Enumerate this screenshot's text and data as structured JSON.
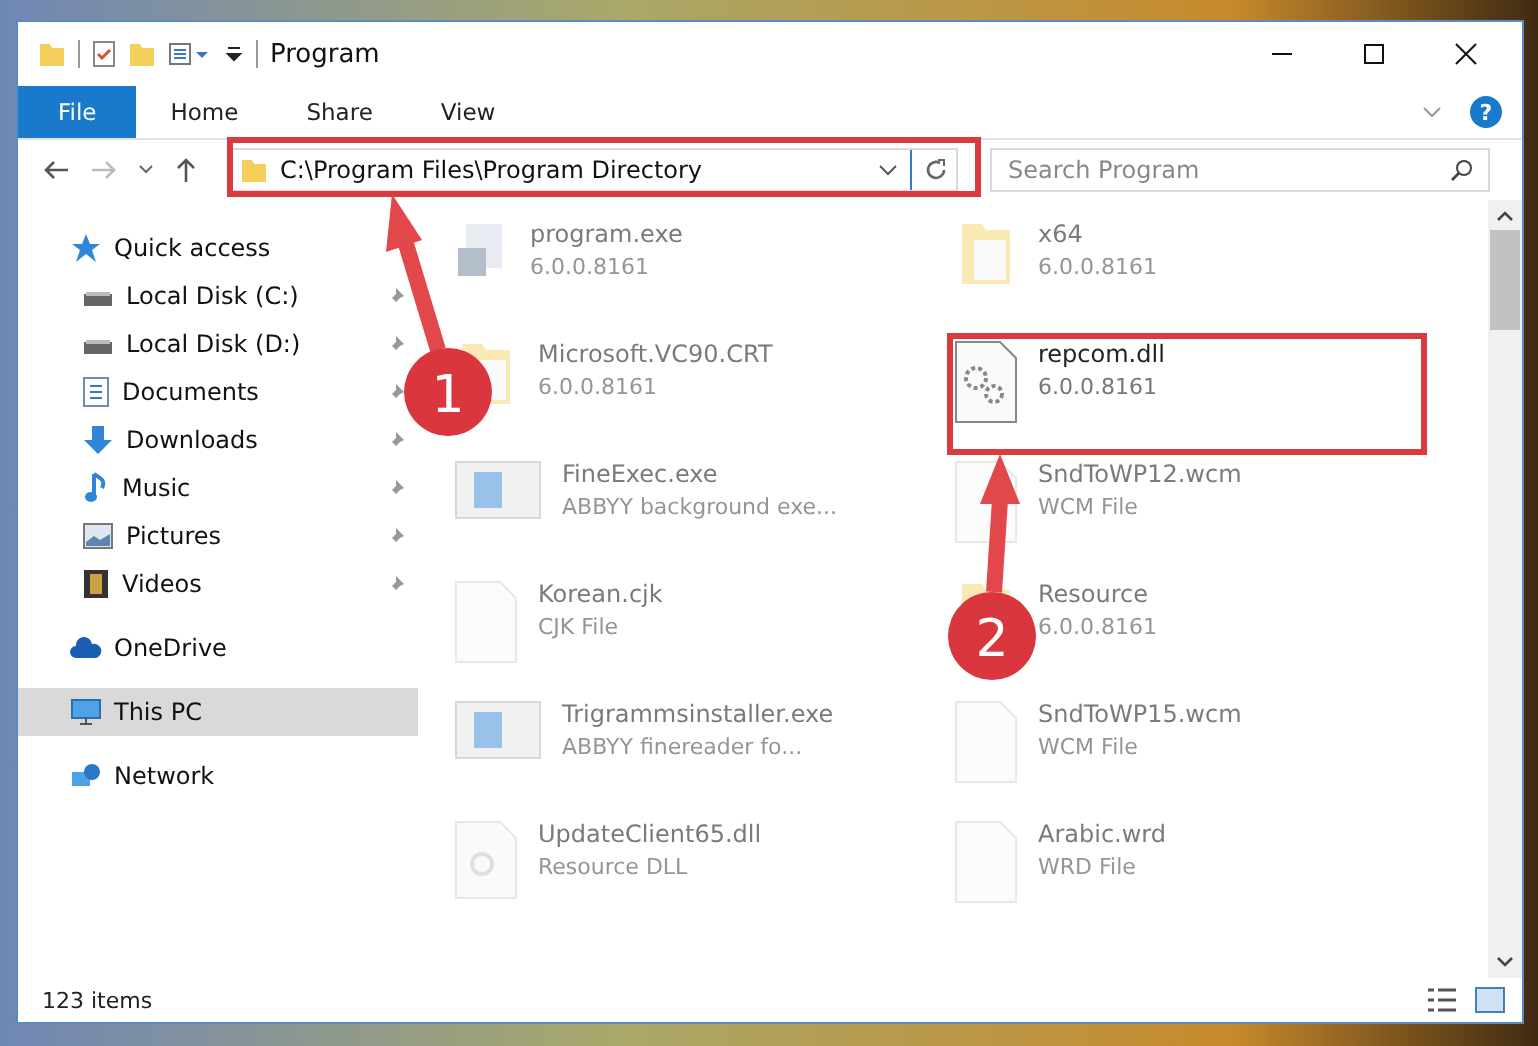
{
  "window": {
    "title": "Program"
  },
  "ribbon_tabs": [
    {
      "label": "File",
      "selected": true
    },
    {
      "label": "Home",
      "selected": false
    },
    {
      "label": "Share",
      "selected": false
    },
    {
      "label": "View",
      "selected": false
    }
  ],
  "help_button": "?",
  "address": {
    "path": "C:\\Program Files\\Program Directory"
  },
  "search": {
    "placeholder": "Search Program"
  },
  "sidebar": {
    "items": [
      {
        "label": "Quick access",
        "kind": "star",
        "selected": false,
        "children": [
          {
            "label": "Local Disk (C:)",
            "kind": "drive",
            "pinned": true,
            "selected": false
          },
          {
            "label": "Local Disk (D:)",
            "kind": "drive",
            "pinned": true,
            "selected": false
          },
          {
            "label": "Documents",
            "kind": "document",
            "pinned": true,
            "selected": false
          },
          {
            "label": "Downloads",
            "kind": "download",
            "pinned": true,
            "selected": false
          },
          {
            "label": "Music",
            "kind": "music",
            "pinned": true,
            "selected": false
          },
          {
            "label": "Pictures",
            "kind": "picture",
            "pinned": true,
            "selected": false
          },
          {
            "label": "Videos",
            "kind": "video",
            "pinned": true,
            "selected": false
          }
        ]
      },
      {
        "label": "OneDrive",
        "kind": "cloud",
        "selected": false
      },
      {
        "label": "This PC",
        "kind": "pc",
        "selected": true
      },
      {
        "label": "Network",
        "kind": "network",
        "selected": false
      }
    ]
  },
  "files": [
    {
      "name": "program.exe",
      "detail": "6.0.0.8161",
      "kind": "exe",
      "faded": true
    },
    {
      "name": "x64",
      "detail": "6.0.0.8161",
      "kind": "folder",
      "faded": true
    },
    {
      "name": "Microsoft.VC90.CRT",
      "detail": "6.0.0.8161",
      "kind": "folder",
      "faded": true
    },
    {
      "name": "repcom.dll",
      "detail": "6.0.0.8161",
      "kind": "gears",
      "faded": false
    },
    {
      "name": "FineExec.exe",
      "detail": "ABBYY background exe...",
      "kind": "app",
      "faded": true
    },
    {
      "name": "SndToWP12.wcm",
      "detail": "WCM File",
      "kind": "file",
      "faded": true
    },
    {
      "name": "Korean.cjk",
      "detail": "CJK File",
      "kind": "file",
      "faded": true
    },
    {
      "name": "Resource",
      "detail": "6.0.0.8161",
      "kind": "folder",
      "faded": true
    },
    {
      "name": "Trigrammsinstaller.exe",
      "detail": "ABBYY finereader fo...",
      "kind": "app",
      "faded": true
    },
    {
      "name": "SndToWP15.wcm",
      "detail": "WCM File",
      "kind": "file",
      "faded": true
    },
    {
      "name": "UpdateClient65.dll",
      "detail": "Resource DLL",
      "kind": "dll",
      "faded": true
    },
    {
      "name": "Arabic.wrd",
      "detail": "WRD File",
      "kind": "file",
      "faded": true
    }
  ],
  "status_bar": {
    "item_count": "123 items"
  },
  "annotations": [
    {
      "number": "1"
    },
    {
      "number": "2"
    }
  ]
}
